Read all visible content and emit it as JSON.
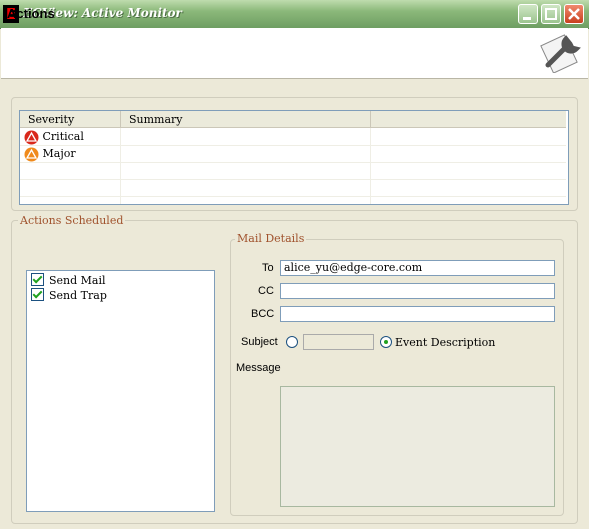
{
  "window": {
    "title": "ECView: Active Monitor",
    "app_icon": "E"
  },
  "header": {
    "title": "Actions",
    "icon": "wrench-document-icon"
  },
  "severity_table": {
    "columns": [
      "Severity",
      "Summary",
      ""
    ],
    "rows": [
      {
        "severity": "Critical",
        "icon": "critical-icon",
        "color": "#d9281c"
      },
      {
        "severity": "Major",
        "icon": "major-icon",
        "color": "#f08a1c"
      }
    ]
  },
  "actions_scheduled": {
    "legend": "Actions Scheduled",
    "items": [
      {
        "label": "Send Mail",
        "checked": true
      },
      {
        "label": "Send Trap",
        "checked": true
      }
    ]
  },
  "mail_details": {
    "legend": "Mail Details",
    "to_label": "To",
    "to_value": "alice_yu@edge-core.com",
    "cc_label": "CC",
    "cc_value": "",
    "bcc_label": "BCC",
    "bcc_value": "",
    "subject_label": "Subject",
    "subject_value": "",
    "event_description_label": "Event Description",
    "event_description_selected": true,
    "message_label": "Message",
    "message_value": ""
  }
}
